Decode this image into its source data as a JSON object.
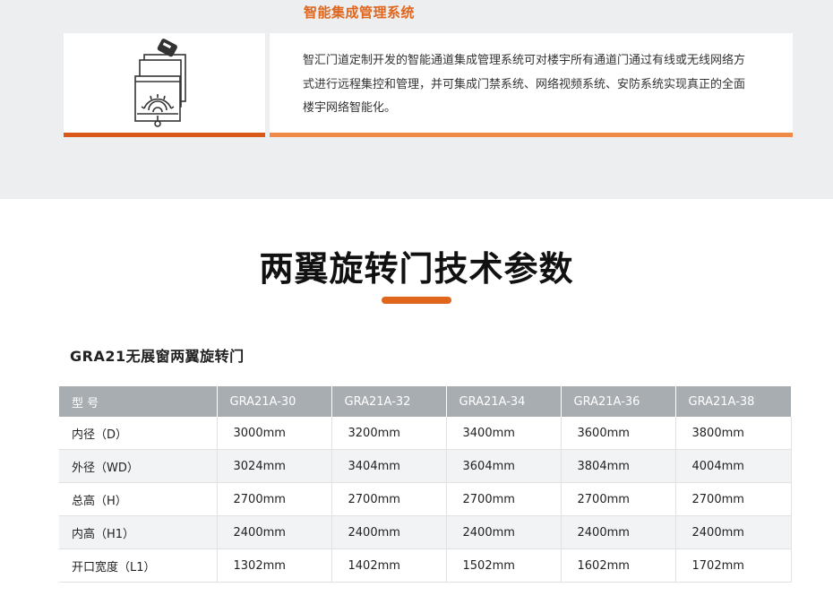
{
  "system_section": {
    "heading": "智能集成管理系统",
    "icon": "access-control-system-icon",
    "description": "智汇门道定制开发的智能通道集成管理系统可对楼宇所有通道门通过有线或无线网络方式进行远程集控和管理，并可集成门禁系统、网络视频系统、安防系统实现真正的全面楼宇网络智能化。"
  },
  "specs_section": {
    "title": "两翼旋转门技术参数",
    "product_name": "GRA21无展窗两翼旋转门",
    "table": {
      "headers": [
        "型 号",
        "GRA21A-30",
        "GRA21A-32",
        "GRA21A-34",
        "GRA21A-36",
        "GRA21A-38"
      ],
      "rows": [
        [
          "内径（D）",
          "3000mm",
          "3200mm",
          "3400mm",
          "3600mm",
          "3800mm"
        ],
        [
          "外径（WD）",
          "3024mm",
          "3404mm",
          "3604mm",
          "3804mm",
          "4004mm"
        ],
        [
          "总高（H）",
          "2700mm",
          "2700mm",
          "2700mm",
          "2700mm",
          "2700mm"
        ],
        [
          "内高（H1）",
          "2400mm",
          "2400mm",
          "2400mm",
          "2400mm",
          "2400mm"
        ],
        [
          "开口宽度（L1）",
          "1302mm",
          "1402mm",
          "1502mm",
          "1602mm",
          "1702mm"
        ]
      ]
    }
  },
  "colors": {
    "accent": "#e0661d",
    "accent_dark_bar": "#d9581a",
    "accent_light_bar": "#ef8a48",
    "table_header": "#a8adb2",
    "band_background": "#eceef0"
  }
}
